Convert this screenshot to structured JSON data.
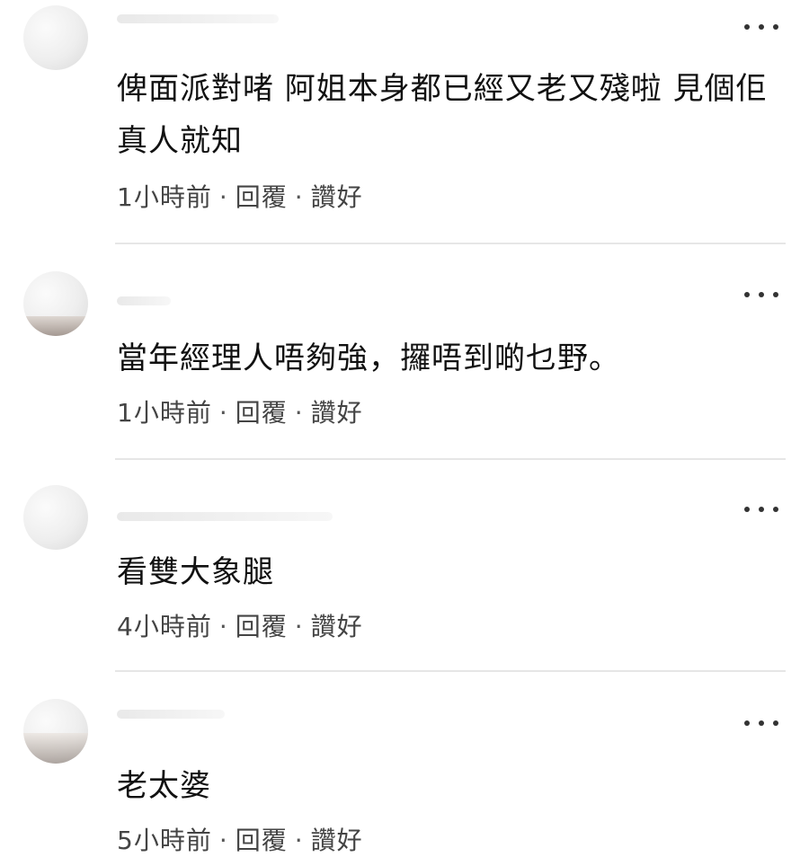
{
  "comments": [
    {
      "text": "俾面派對啫  阿姐本身都已經又老又殘啦  見個佢真人就知",
      "time": "1小時前",
      "reply": "回覆",
      "like": "讚好"
    },
    {
      "text": "當年經理人唔夠強，攞唔到啲乜野。",
      "time": "1小時前",
      "reply": "回覆",
      "like": "讚好"
    },
    {
      "text": "看雙大象腿",
      "time": "4小時前",
      "reply": "回覆",
      "like": "讚好"
    },
    {
      "text": "老太婆",
      "time": "5小時前",
      "reply": "回覆",
      "like": "讚好"
    }
  ],
  "separator": "·",
  "icons": {
    "more": "more-options-icon"
  }
}
